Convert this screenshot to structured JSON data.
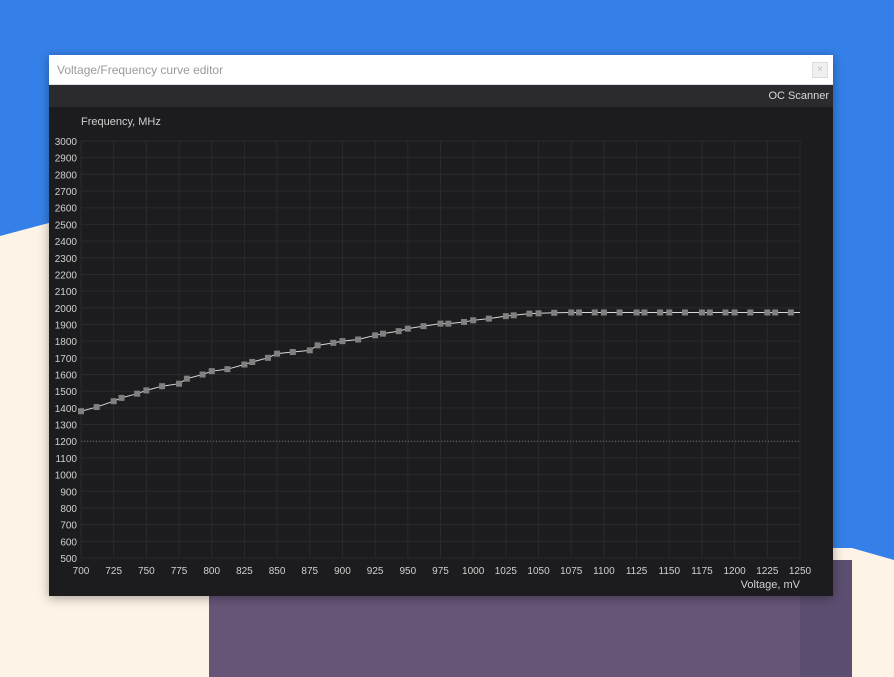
{
  "window": {
    "title": "Voltage/Frequency curve editor",
    "close_label": "×"
  },
  "toolbar": {
    "oc_scanner_label": "OC Scanner"
  },
  "colors": {
    "desktop_blue": "#3580e8",
    "desktop_cream": "#fdf3e6",
    "desktop_purple": "#655577",
    "plot_bg": "#1c1c1f",
    "grid": "#2a2a2e",
    "curve": "#d8d8d8",
    "point": "#808080",
    "dotted_line": "#6a6a6a"
  },
  "chart_data": {
    "type": "line",
    "ylabel": "Frequency, MHz",
    "xlabel": "Voltage, mV",
    "xlim": [
      700,
      1250
    ],
    "ylim": [
      500,
      3000
    ],
    "x_ticks": [
      700,
      725,
      750,
      775,
      800,
      825,
      850,
      875,
      900,
      925,
      950,
      975,
      1000,
      1025,
      1050,
      1075,
      1100,
      1125,
      1150,
      1175,
      1200,
      1225,
      1250
    ],
    "y_ticks": [
      500,
      600,
      700,
      800,
      900,
      1000,
      1100,
      1200,
      1300,
      1400,
      1500,
      1600,
      1700,
      1800,
      1900,
      2000,
      2100,
      2200,
      2300,
      2400,
      2500,
      2600,
      2700,
      2800,
      2900,
      3000
    ],
    "grid": true,
    "reference_line_y": 1200,
    "series": [
      {
        "x": [
          700,
          712,
          725,
          731,
          743,
          750,
          762,
          775,
          781,
          793,
          800,
          812,
          825,
          831,
          843,
          850,
          862,
          875,
          881,
          893,
          900,
          912,
          925,
          931,
          943,
          950,
          962,
          975,
          981,
          993,
          1000,
          1012,
          1025,
          1031,
          1043,
          1050,
          1062,
          1075,
          1081,
          1093,
          1100,
          1112,
          1125,
          1131,
          1143,
          1150,
          1162,
          1175,
          1181,
          1193,
          1200,
          1212,
          1225,
          1231,
          1243
        ],
        "y": [
          1380,
          1405,
          1440,
          1460,
          1485,
          1505,
          1530,
          1545,
          1575,
          1600,
          1620,
          1632,
          1660,
          1675,
          1700,
          1725,
          1735,
          1745,
          1775,
          1790,
          1800,
          1810,
          1835,
          1845,
          1860,
          1875,
          1890,
          1905,
          1905,
          1915,
          1925,
          1935,
          1950,
          1955,
          1965,
          1967,
          1970,
          1972,
          1972,
          1972,
          1972,
          1972,
          1972,
          1972,
          1972,
          1972,
          1972,
          1972,
          1972,
          1972,
          1972,
          1972,
          1972,
          1972,
          1972
        ]
      }
    ]
  }
}
